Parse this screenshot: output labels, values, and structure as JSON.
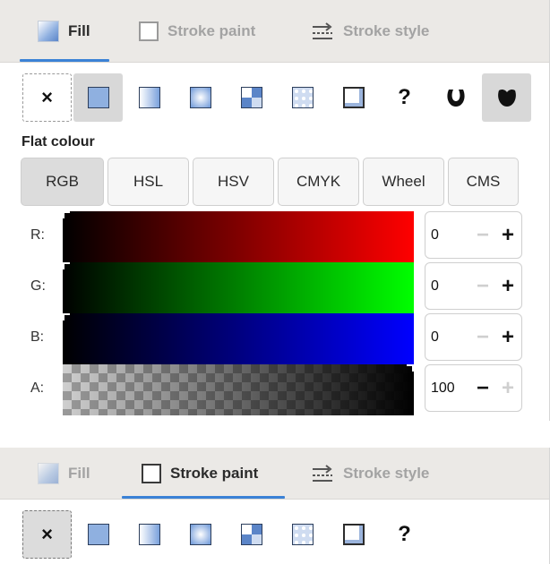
{
  "panel1": {
    "tabs": [
      {
        "label": "Fill",
        "active": true
      },
      {
        "label": "Stroke paint",
        "active": false
      },
      {
        "label": "Stroke style",
        "active": false
      }
    ],
    "mode_buttons": [
      "none",
      "flat-colour",
      "linear-gradient",
      "radial-gradient",
      "mesh-gradient",
      "pattern",
      "swatch",
      "unset",
      "evenodd",
      "nonzero"
    ],
    "none_symbol": "×",
    "unset_symbol": "?",
    "flat_label": "Flat colour",
    "color_modes": [
      "RGB",
      "HSL",
      "HSV",
      "CMYK",
      "Wheel",
      "CMS"
    ],
    "active_color_mode": "RGB",
    "channels": [
      {
        "label": "R:",
        "value": "0"
      },
      {
        "label": "G:",
        "value": "0"
      },
      {
        "label": "B:",
        "value": "0"
      },
      {
        "label": "A:",
        "value": "100"
      }
    ],
    "minus": "−",
    "plus": "+"
  },
  "panel2": {
    "tabs": [
      {
        "label": "Fill",
        "active": false
      },
      {
        "label": "Stroke paint",
        "active": true
      },
      {
        "label": "Stroke style",
        "active": false
      }
    ],
    "none_symbol": "×",
    "unset_symbol": "?"
  },
  "colors": {
    "accent": "#3b82d6",
    "tab_bg": "#ebe9e6",
    "active_button": "#d8d8d8"
  }
}
